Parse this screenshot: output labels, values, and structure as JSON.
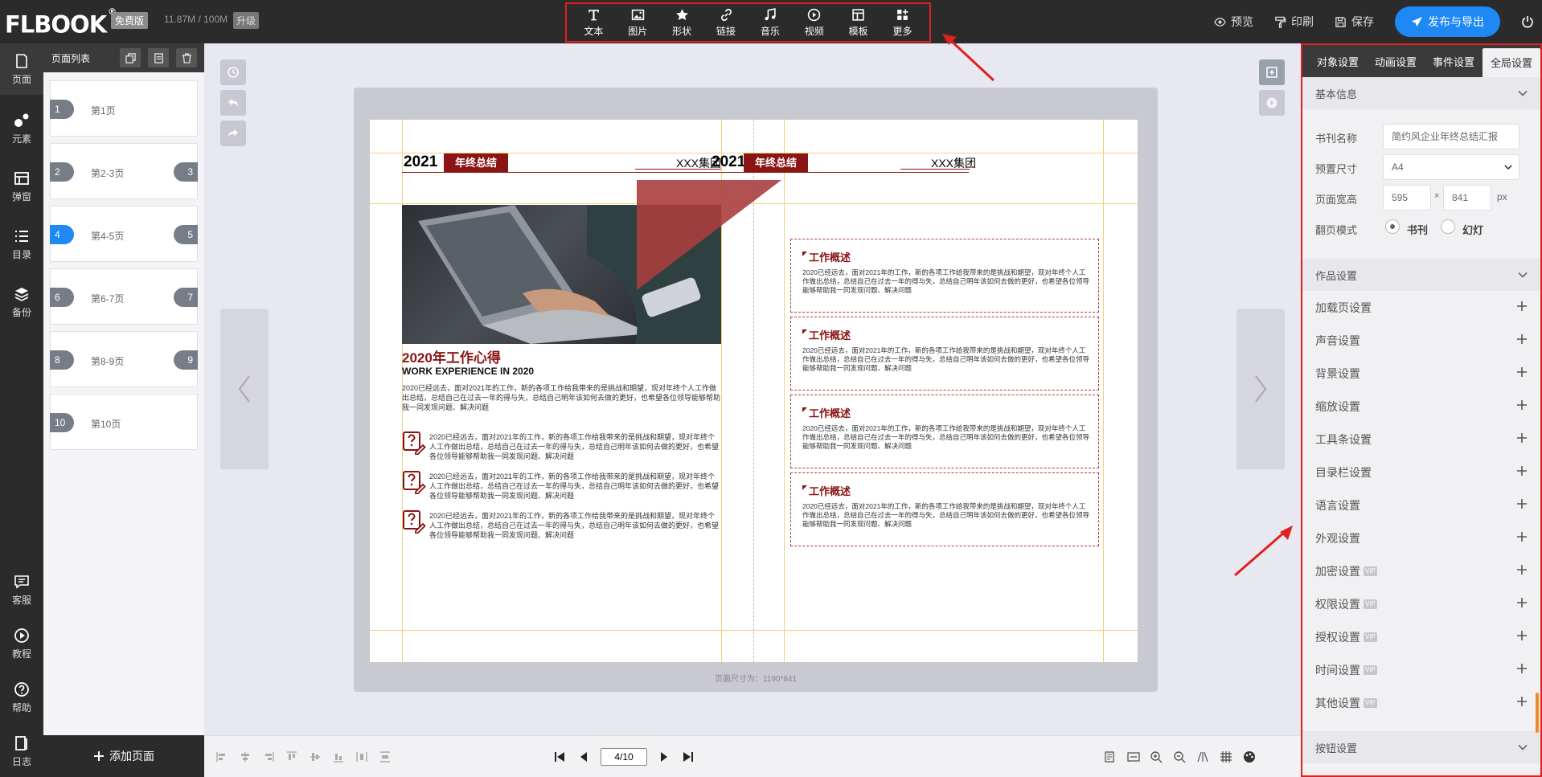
{
  "app": {
    "logo": "FLBOOK",
    "logo_mark": "®",
    "plan_badge": "免费版",
    "storage": "11.87M / 100M",
    "upgrade": "升级"
  },
  "toolbar": {
    "items": [
      {
        "label": "文本",
        "icon": "text-icon"
      },
      {
        "label": "图片",
        "icon": "image-icon"
      },
      {
        "label": "形状",
        "icon": "star-icon"
      },
      {
        "label": "链接",
        "icon": "link-icon"
      },
      {
        "label": "音乐",
        "icon": "music-icon"
      },
      {
        "label": "视频",
        "icon": "video-icon"
      },
      {
        "label": "模板",
        "icon": "template-icon"
      },
      {
        "label": "更多",
        "icon": "more-icon"
      }
    ]
  },
  "top_right": {
    "preview": "预览",
    "print": "印刷",
    "save": "保存",
    "publish": "发布与导出"
  },
  "leftnav": {
    "items": [
      "页面",
      "元素",
      "弹窗",
      "目录",
      "备份"
    ],
    "bottom": [
      "客服",
      "教程",
      "帮助",
      "日志"
    ]
  },
  "page_panel": {
    "title": "页面列表",
    "pages": [
      {
        "left": "1",
        "label": "第1页",
        "right": ""
      },
      {
        "left": "2",
        "label": "第2-3页",
        "right": "3"
      },
      {
        "left": "4",
        "label": "第4-5页",
        "right": "5",
        "active": true
      },
      {
        "left": "6",
        "label": "第6-7页",
        "right": "7"
      },
      {
        "left": "8",
        "label": "第8-9页",
        "right": "9"
      },
      {
        "left": "10",
        "label": "第10页",
        "right": ""
      }
    ],
    "add_page": "添加页面"
  },
  "book": {
    "left": {
      "year": "2021",
      "tag": "年终总结",
      "company": "XXX集团",
      "heading": "2020年工作心得",
      "subheading": "WORK EXPERIENCE IN 2020",
      "intro": "2020已经远去，面对2021年的工作，新的各项工作给我带来的是挑战和期望，现对年终个人工作做出总结，总结自己在过去一年的得与失，总结自己明年该如何去做的更好，也希望各位领导能够帮助我一同发现问题、解决问题",
      "items": [
        "2020已经远去，面对2021年的工作，新的各项工作给我带来的是挑战和期望，现对年终个人工作做出总结，总结自己在过去一年的得与失，总结自己明年该如何去做的更好，也希望各位领导能够帮助我一同发现问题、解决问题",
        "2020已经远去，面对2021年的工作，新的各项工作给我带来的是挑战和期望，现对年终个人工作做出总结，总结自己在过去一年的得与失，总结自己明年该如何去做的更好，也希望各位领导能够帮助我一同发现问题、解决问题",
        "2020已经远去，面对2021年的工作，新的各项工作给我带来的是挑战和期望，现对年终个人工作做出总结，总结自己在过去一年的得与失，总结自己明年该如何去做的更好，也希望各位领导能够帮助我一同发现问题、解决问题"
      ]
    },
    "right": {
      "year": "2021",
      "tag": "年终总结",
      "company": "XXX集团",
      "cards": [
        {
          "title": "工作概述",
          "text": "2020已经远去，面对2021年的工作，新的各项工作给我带来的是挑战和期望，现对年终个人工作做出总结，总结自己在过去一年的得与失，总结自己明年该如何去做的更好，也希望各位领导能够帮助我一同发现问题、解决问题"
        },
        {
          "title": "工作概述",
          "text": "2020已经远去，面对2021年的工作，新的各项工作给我带来的是挑战和期望，现对年终个人工作做出总结，总结自己在过去一年的得与失，总结自己明年该如何去做的更好，也希望各位领导能够帮助我一同发现问题、解决问题"
        },
        {
          "title": "工作概述",
          "text": "2020已经远去，面对2021年的工作，新的各项工作给我带来的是挑战和期望，现对年终个人工作做出总结，总结自己在过去一年的得与失，总结自己明年该如何去做的更好，也希望各位领导能够帮助我一同发现问题、解决问题"
        },
        {
          "title": "工作概述",
          "text": "2020已经远去，面对2021年的工作，新的各项工作给我带来的是挑战和期望，现对年终个人工作做出总结，总结自己在过去一年的得与失，总结自己明年该如何去做的更好，也希望各位领导能够帮助我一同发现问题、解决问题"
        }
      ]
    },
    "page_size_label": "页面尺寸为：1190*841"
  },
  "bottom": {
    "page_indicator": "4/10"
  },
  "right_panel": {
    "tabs": [
      "对象设置",
      "动画设置",
      "事件设置",
      "全局设置"
    ],
    "active_tab": 3,
    "basic_info": "基本信息",
    "book_name_label": "书刊名称",
    "book_name_placeholder": "简约风企业年终总结汇报",
    "preset_size_label": "预置尺寸",
    "preset_size": "A4",
    "page_wh_label": "页面宽高",
    "width": "595",
    "height": "841",
    "times": "×",
    "unit": "px",
    "flip_mode_label": "翻页模式",
    "flip_book": "书刊",
    "flip_slide": "幻灯",
    "work_settings": "作品设置",
    "settings": [
      {
        "label": "加载页设置",
        "vip": ""
      },
      {
        "label": "声音设置",
        "vip": ""
      },
      {
        "label": "背景设置",
        "vip": ""
      },
      {
        "label": "缩放设置",
        "vip": ""
      },
      {
        "label": "工具条设置",
        "vip": ""
      },
      {
        "label": "目录栏设置",
        "vip": ""
      },
      {
        "label": "语言设置",
        "vip": ""
      },
      {
        "label": "外观设置",
        "vip": ""
      },
      {
        "label": "加密设置",
        "vip": "VIP"
      },
      {
        "label": "权限设置",
        "vip": "VIP"
      },
      {
        "label": "授权设置",
        "vip": "VIP"
      },
      {
        "label": "时间设置",
        "vip": "VIP"
      },
      {
        "label": "其他设置",
        "vip": "VIP"
      }
    ],
    "button_settings": "按钮设置"
  },
  "colors": {
    "accent": "#1e88f5",
    "brand_red": "#8b1414",
    "highlight": "#e02020"
  }
}
